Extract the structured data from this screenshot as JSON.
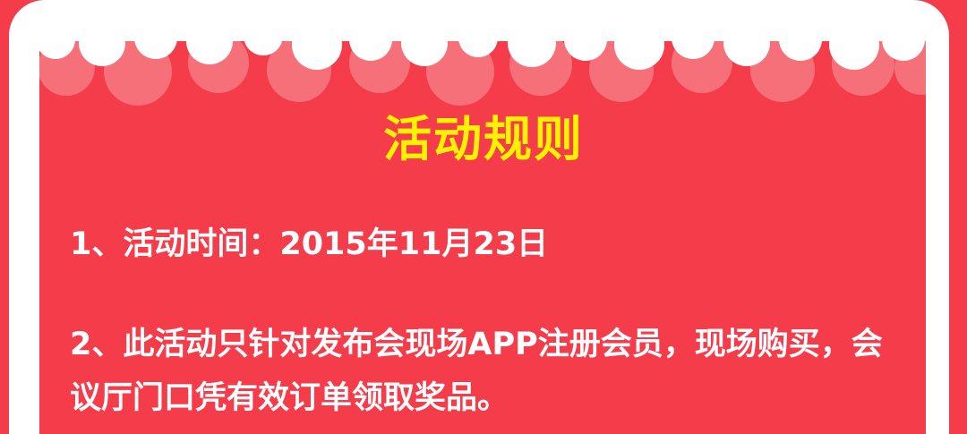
{
  "title": "活动规则",
  "rules": [
    "1、活动时间：2015年11月23日",
    "2、此活动只针对发布会现场APP注册会员，现场购买，会议厅门口凭有效订单领取奖品。"
  ],
  "colors": {
    "background": "#f43c4b",
    "title": "#fff200",
    "text": "#ffffff",
    "cloud_shadow": "#f6707a"
  }
}
